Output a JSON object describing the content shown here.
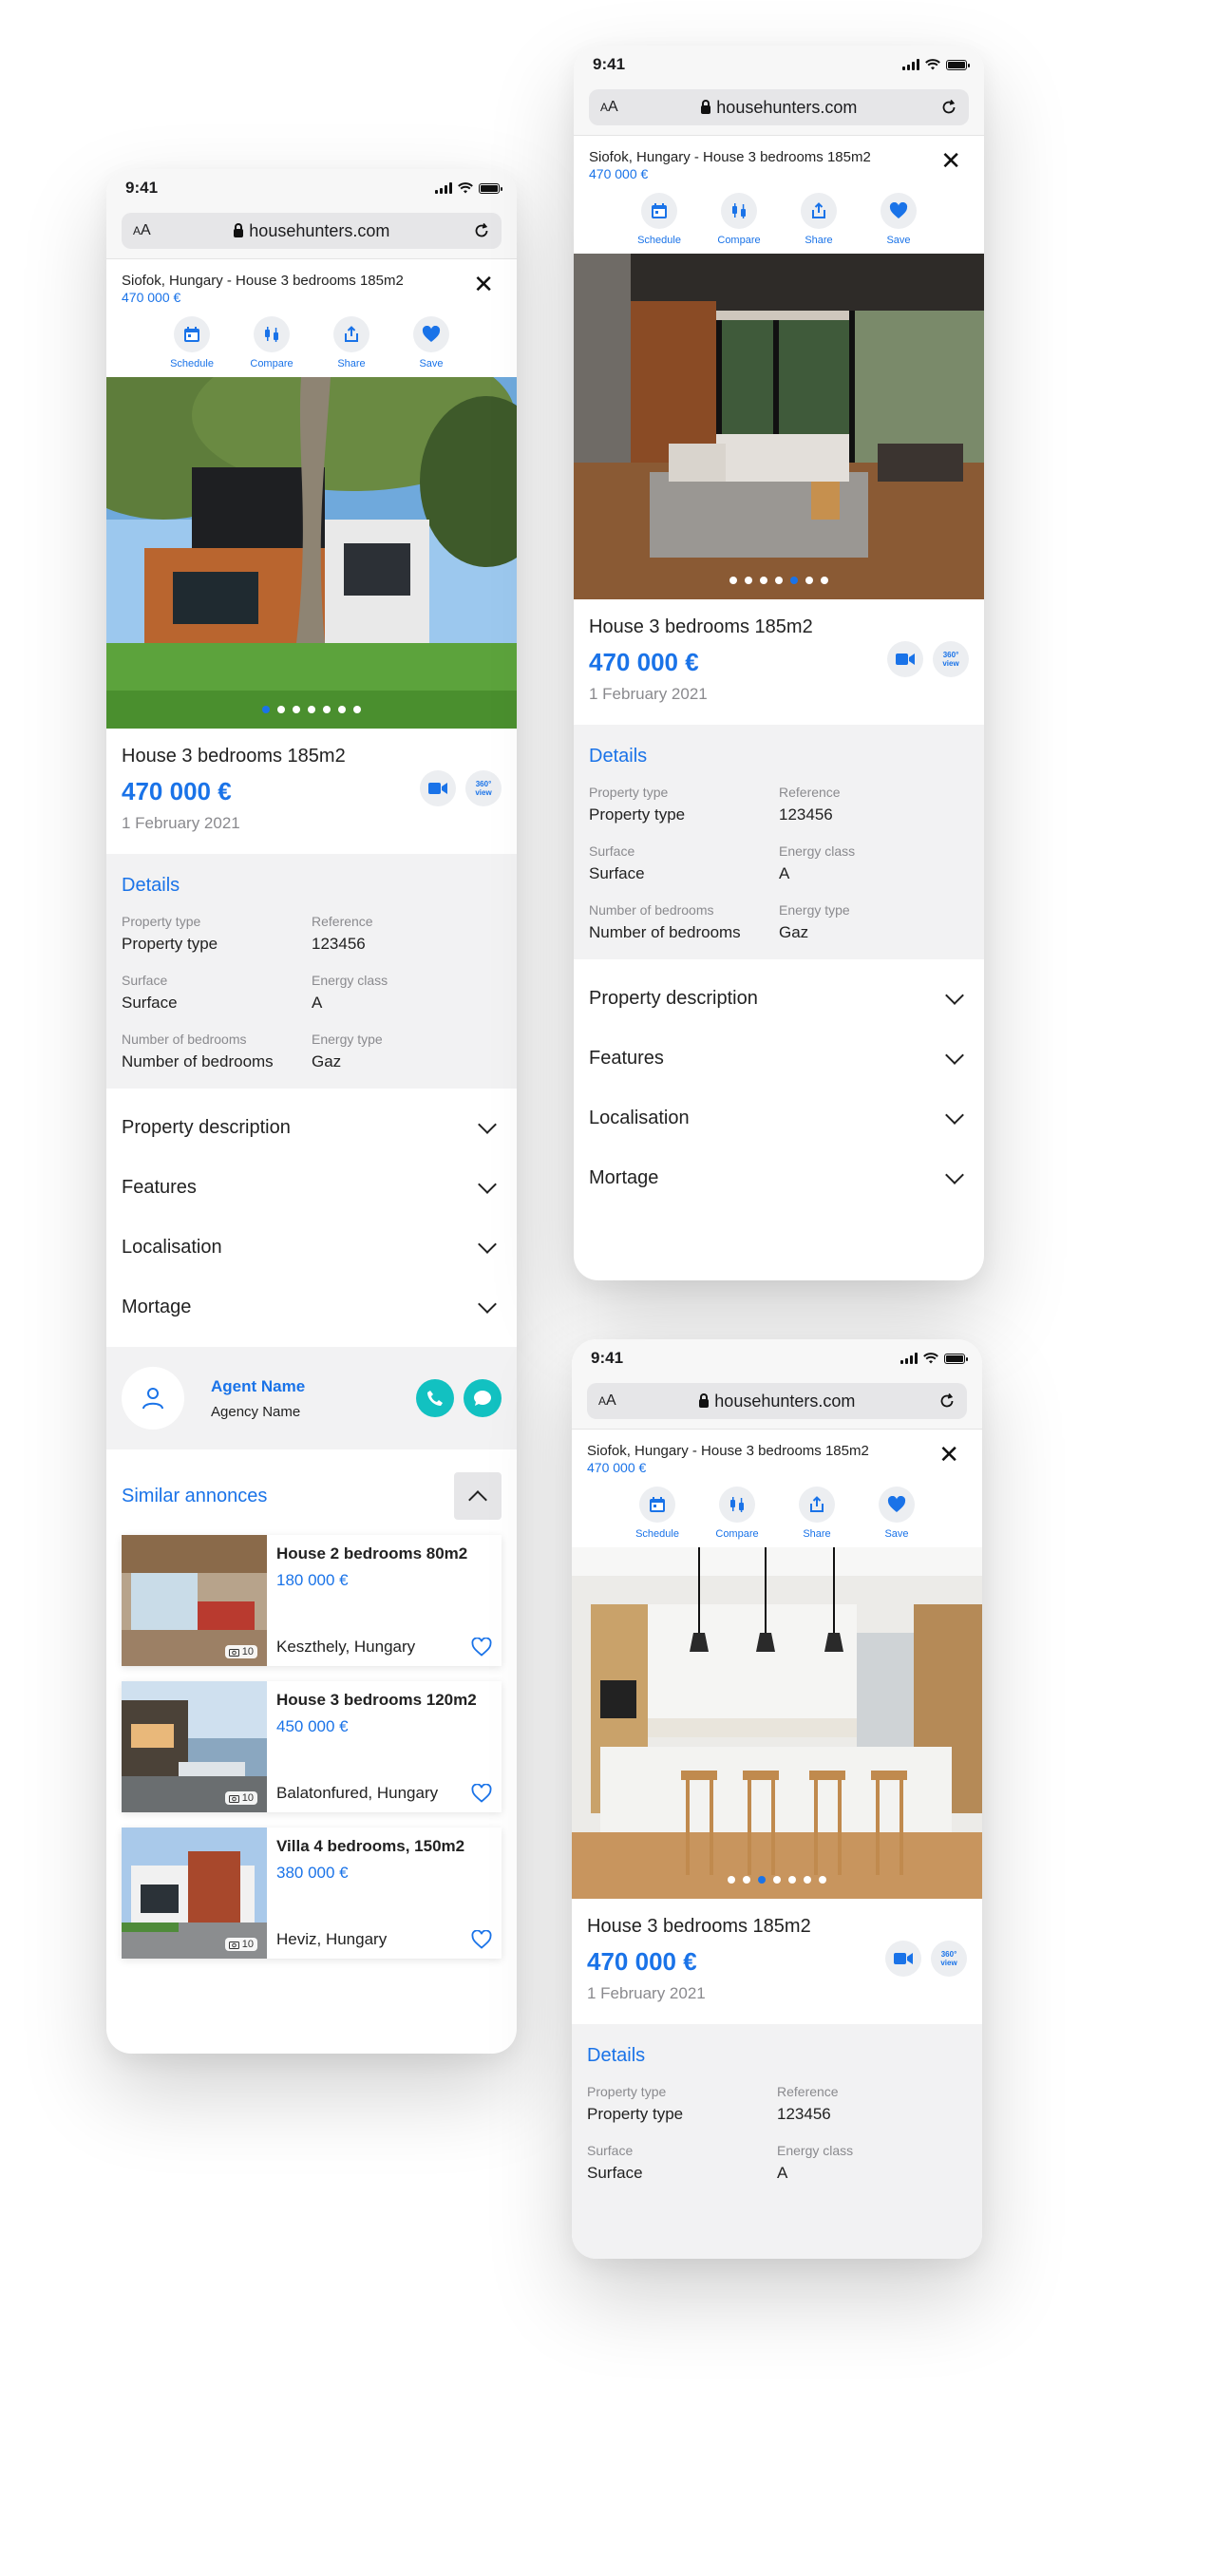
{
  "status": {
    "time": "9:41"
  },
  "browser": {
    "aa_small": "A",
    "aa_big": "A",
    "host": "househunters.com"
  },
  "listing": {
    "header_title": "Siofok, Hungary - House 3 bedrooms 185m2",
    "header_price": "470 000 €",
    "title": "House 3 bedrooms 185m2",
    "price": "470 000 €",
    "date": "1 February 2021",
    "v360_top": "360°",
    "v360_bottom": "view"
  },
  "actions": {
    "schedule": "Schedule",
    "compare": "Compare",
    "share": "Share",
    "save": "Save"
  },
  "details": {
    "heading": "Details",
    "property_type_label": "Property type",
    "property_type_value": "Property type",
    "reference_label": "Reference",
    "reference_value": "123456",
    "surface_label": "Surface",
    "surface_value": "Surface",
    "energy_class_label": "Energy class",
    "energy_class_value": "A",
    "bedrooms_label": "Number of bedrooms",
    "bedrooms_value": "Number of bedrooms",
    "energy_type_label": "Energy type",
    "energy_type_value": "Gaz"
  },
  "accordion": [
    "Property description",
    "Features",
    "Localisation",
    "Mortage"
  ],
  "agent": {
    "name": "Agent Name",
    "agency": "Agency Name"
  },
  "similar": {
    "heading": "Similar annonces",
    "items": [
      {
        "title": "House 2 bedrooms 80m2",
        "price": "180 000 €",
        "location": "Keszthely, Hungary",
        "photos": "10"
      },
      {
        "title": "House 3 bedrooms 120m2",
        "price": "450 000 €",
        "location": "Balatonfured, Hungary",
        "photos": "10"
      },
      {
        "title": "Villa 4 bedrooms, 150m2",
        "price": "380 000 €",
        "location": "Heviz, Hungary",
        "photos": "10"
      }
    ]
  },
  "carousel": {
    "phone1_active": 1,
    "phone2_active": 5,
    "phone3_active": 3,
    "count": 7
  },
  "colors": {
    "accent": "#1a73e8",
    "teal": "#12c1c1",
    "panel": "#f2f2f3"
  }
}
